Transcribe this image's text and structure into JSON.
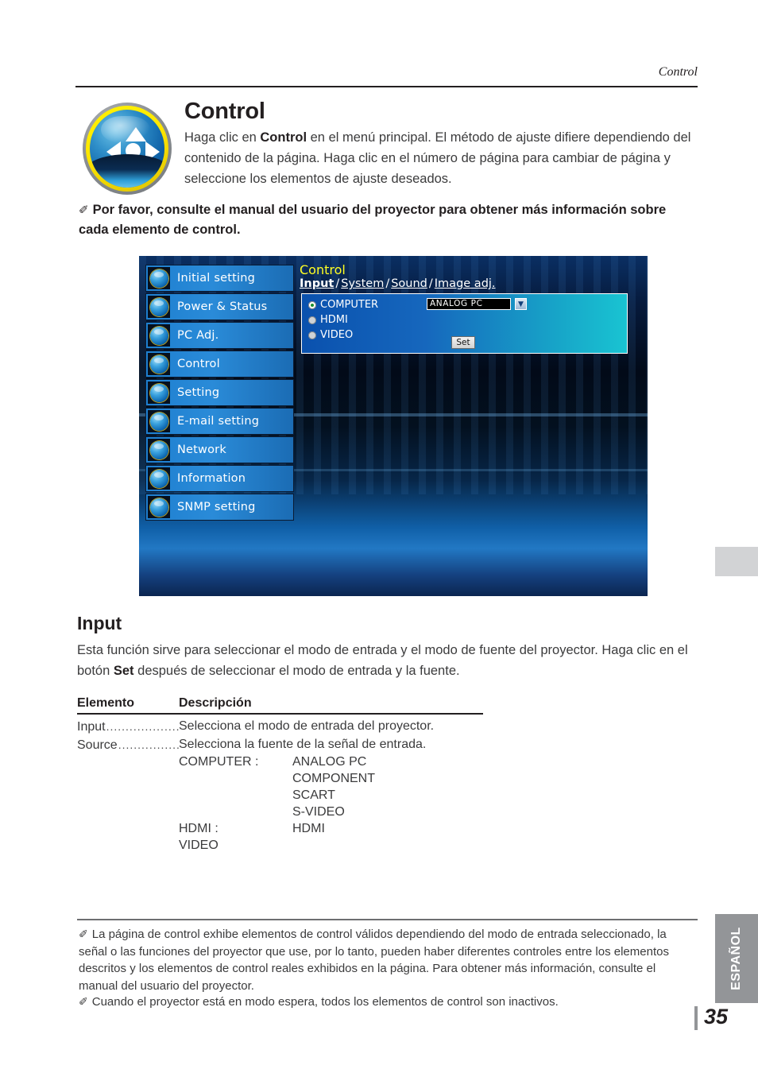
{
  "header": {
    "running_title": "Control"
  },
  "title_block": {
    "icon": "direction-pad-sphere-icon",
    "heading": "Control",
    "paragraph_pre": "Haga clic en ",
    "paragraph_bold": "Control",
    "paragraph_post": " en el menú principal. El método de ajuste difiere dependiendo del contenido de la página. Haga clic en el número de página para cambiar de página y seleccione los elementos de ajuste deseados.",
    "note_pencil": "✐",
    "note_bold": "Por favor, consulte el manual del usuario del proyector para obtener más información sobre cada elemento de control."
  },
  "screenshot": {
    "menu_items": [
      {
        "label": "Initial setting",
        "icon": "initial-setting-icon"
      },
      {
        "label": "Power & Status",
        "icon": "power-status-icon"
      },
      {
        "label": "PC Adj.",
        "icon": "pc-adj-icon"
      },
      {
        "label": "Control",
        "icon": "control-icon"
      },
      {
        "label": "Setting",
        "icon": "setting-icon"
      },
      {
        "label": "E-mail setting",
        "icon": "email-setting-icon"
      },
      {
        "label": "Network",
        "icon": "network-icon"
      },
      {
        "label": "Information",
        "icon": "information-icon"
      },
      {
        "label": "SNMP setting",
        "icon": "snmp-setting-icon"
      }
    ],
    "panel_title": "Control",
    "tabs": [
      {
        "label": "Input",
        "active": true
      },
      {
        "label": "System",
        "active": false
      },
      {
        "label": "Sound",
        "active": false
      },
      {
        "label": "Image adj.",
        "active": false
      }
    ],
    "tab_separator": "/",
    "radios": [
      {
        "label": "COMPUTER",
        "selected": true
      },
      {
        "label": "HDMI",
        "selected": false
      },
      {
        "label": "VIDEO",
        "selected": false
      }
    ],
    "select_value": "ANALOG PC",
    "select_arrow": "▼",
    "set_button": "Set"
  },
  "section": {
    "heading": "Input",
    "para_pre": "Esta función sirve para seleccionar el modo de entrada y el modo de fuente del proyector. Haga clic en el botón ",
    "para_bold": "Set",
    "para_post": " después de seleccionar el modo de entrada y la fuente."
  },
  "table": {
    "headers": {
      "item": "Elemento",
      "description": "Descripción"
    },
    "rows": [
      {
        "item": "Input",
        "leader": "........................",
        "description": "Selecciona el modo de entrada del proyector."
      },
      {
        "item": "Source",
        "leader": ".....................",
        "description": "Selecciona la fuente de la señal de entrada."
      }
    ],
    "sub_rows": [
      {
        "key": "COMPUTER :",
        "value": "ANALOG PC"
      },
      {
        "key": "",
        "value": "COMPONENT"
      },
      {
        "key": "",
        "value": "SCART"
      },
      {
        "key": "",
        "value": "S-VIDEO"
      },
      {
        "key": "HDMI :",
        "value": "HDMI"
      },
      {
        "key": "VIDEO",
        "value": ""
      }
    ]
  },
  "footnotes": {
    "pencil": "✐",
    "note1": "La página de control exhibe elementos de control válidos dependiendo del modo de entrada seleccionado, la señal o las funciones del proyector que use, por lo tanto, pueden haber diferentes controles entre los elementos descritos y los elementos de control reales exhibidos en la página. Para obtener más información, consulte el manual del usuario del proyector.",
    "note2": "Cuando el proyector está en modo espera, todos los elementos de control son inactivos."
  },
  "side": {
    "language_tab": "ESPAÑOL",
    "page_number": "35"
  }
}
